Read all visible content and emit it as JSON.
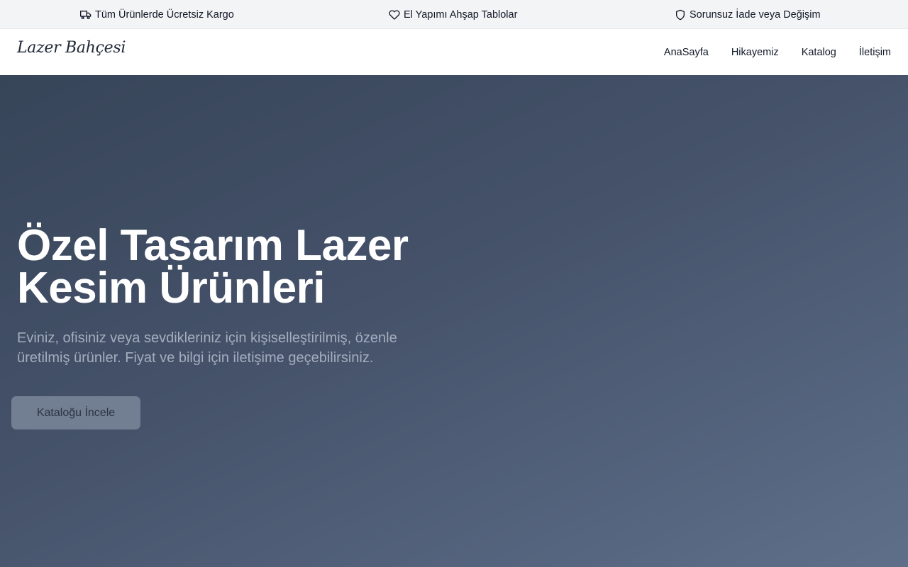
{
  "announcements": [
    {
      "icon": "truck-icon",
      "text": "Tüm Ürünlerde Ücretsiz Kargo"
    },
    {
      "icon": "heart-icon",
      "text": "El Yapımı Ahşap Tablolar"
    },
    {
      "icon": "shield-icon",
      "text": "Sorunsuz İade veya Değişim"
    }
  ],
  "header": {
    "logo": "Lazer Bahçesi",
    "nav": [
      "AnaSayfa",
      "Hikayemiz",
      "Katalog",
      "İletişim"
    ]
  },
  "hero": {
    "title": "Özel Tasarım Lazer Kesim Ürünleri",
    "subtitle": "Eviniz, ofisiniz veya sevdikleriniz için kişiselleştirilmiş, özenle üretilmiş ürünler. Fiyat ve bilgi için iletişime geçebilirsiniz.",
    "cta": "Kataloğu İncele"
  },
  "colors": {
    "topbar_bg": "#f3f4f6",
    "hero_start": "#374559",
    "hero_end": "#5f6f8a",
    "cta_bg": "#727e92"
  }
}
